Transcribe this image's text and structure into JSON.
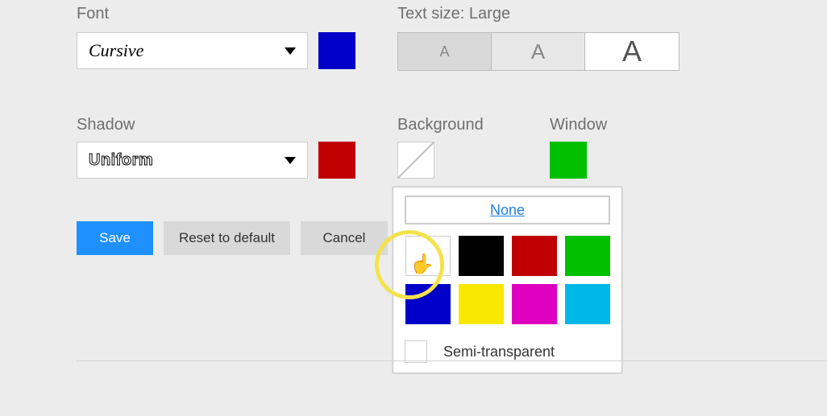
{
  "font": {
    "label": "Font",
    "value": "Cursive",
    "color": "#0000c8"
  },
  "shadow": {
    "label": "Shadow",
    "value": "Uniform",
    "color": "#c00000"
  },
  "textsize": {
    "label": "Text size: Large",
    "options": [
      "A",
      "A",
      "A"
    ],
    "selected": 2
  },
  "background": {
    "label": "Background"
  },
  "window": {
    "label": "Window",
    "color": "#00c000"
  },
  "buttons": {
    "save": "Save",
    "reset": "Reset to default",
    "cancel": "Cancel"
  },
  "colorPicker": {
    "none": "None",
    "colors": [
      {
        "name": "white",
        "hex": "#ffffff"
      },
      {
        "name": "black",
        "hex": "#000000"
      },
      {
        "name": "red",
        "hex": "#c00000"
      },
      {
        "name": "green",
        "hex": "#00c000"
      },
      {
        "name": "blue",
        "hex": "#0000c8"
      },
      {
        "name": "yellow",
        "hex": "#f8e800"
      },
      {
        "name": "magenta",
        "hex": "#e000c0"
      },
      {
        "name": "cyan",
        "hex": "#00b8e8"
      }
    ],
    "semiTransparent": "Semi-transparent"
  }
}
